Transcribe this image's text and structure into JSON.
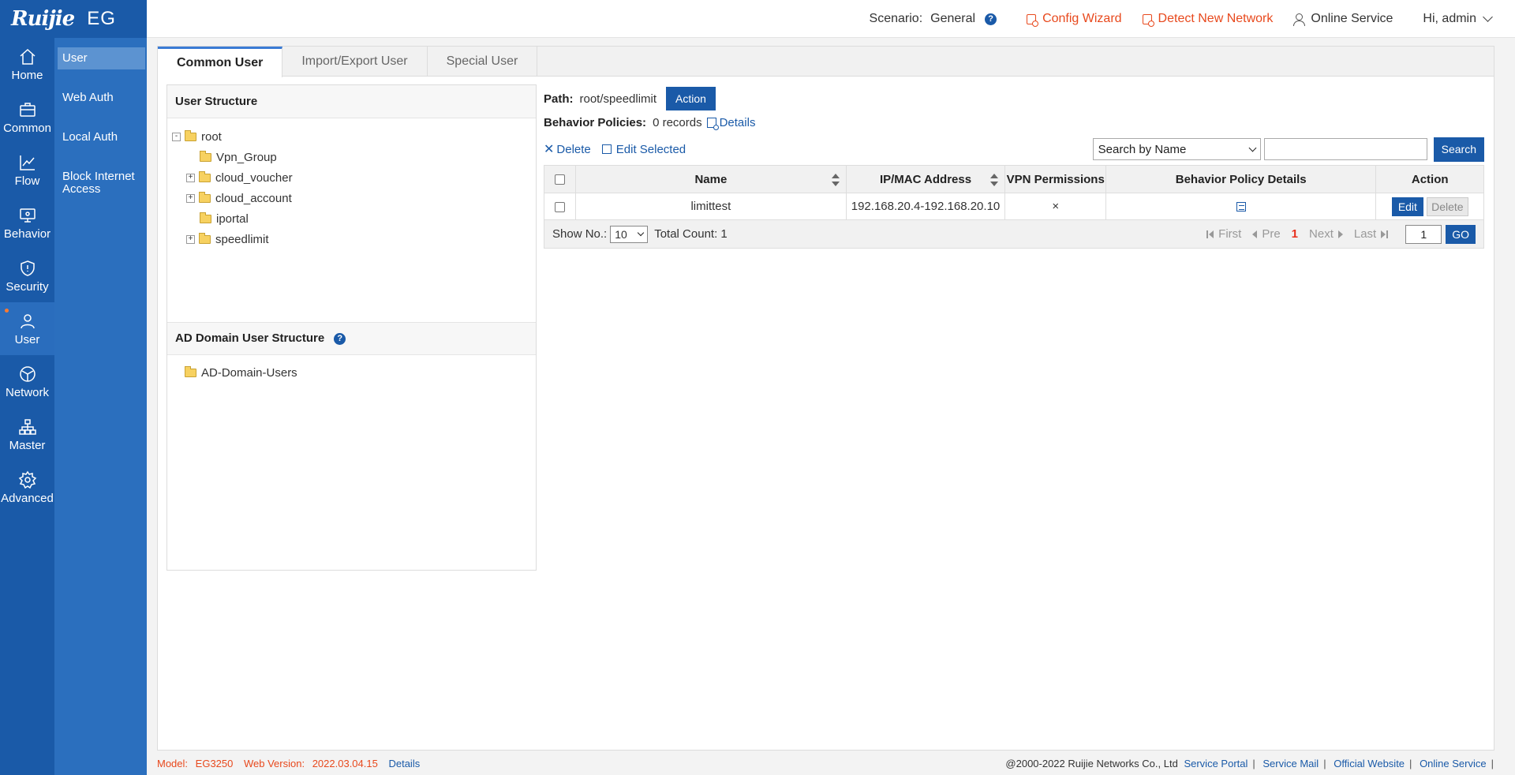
{
  "header": {
    "logo": "Ruijie",
    "product": "EG",
    "scenario_label": "Scenario:",
    "scenario_value": "General",
    "config_wizard": "Config Wizard",
    "detect_network": "Detect New Network",
    "online_service": "Online Service",
    "greeting": "Hi, admin"
  },
  "nav": [
    {
      "label": "Home",
      "icon": "home-icon"
    },
    {
      "label": "Common",
      "icon": "briefcase-icon"
    },
    {
      "label": "Flow",
      "icon": "chart-line-icon"
    },
    {
      "label": "Behavior",
      "icon": "monitor-eye-icon"
    },
    {
      "label": "Security",
      "icon": "shield-icon"
    },
    {
      "label": "User",
      "icon": "user-icon"
    },
    {
      "label": "Network",
      "icon": "globe-icon"
    },
    {
      "label": "Master",
      "icon": "hierarchy-icon"
    },
    {
      "label": "Advanced",
      "icon": "gear-icon"
    }
  ],
  "subnav": [
    "User",
    "Web Auth",
    "Local Auth",
    "Block Internet Access"
  ],
  "tabs": [
    "Common User",
    "Import/Export User",
    "Special User"
  ],
  "user_structure": {
    "title": "User Structure",
    "root": "root",
    "children": [
      "Vpn_Group",
      "cloud_voucher",
      "cloud_account",
      "iportal",
      "speedlimit"
    ]
  },
  "ad_structure": {
    "title": "AD Domain User Structure",
    "node": "AD-Domain-Users"
  },
  "path": {
    "label": "Path:",
    "value": "root/speedlimit",
    "action_button": "Action"
  },
  "behavior": {
    "label": "Behavior Policies:",
    "records": "0 records",
    "details_link": "Details"
  },
  "toolbar": {
    "delete": "Delete",
    "edit_selected": "Edit Selected",
    "search_by": "Search by Name",
    "search_value": "",
    "search_button": "Search"
  },
  "table": {
    "columns": [
      "Name",
      "IP/MAC Address",
      "VPN Permissions",
      "Behavior Policy Details",
      "Action"
    ],
    "rows": [
      {
        "name": "limittest",
        "ip": "192.168.20.4-192.168.20.10",
        "vpn": "×",
        "edit": "Edit",
        "delete": "Delete"
      }
    ]
  },
  "pager": {
    "show_label": "Show No.:",
    "page_size": "10",
    "total": "Total Count: 1",
    "first": "First",
    "pre": "Pre",
    "current": "1",
    "next": "Next",
    "last": "Last",
    "page_input": "1",
    "go": "GO"
  },
  "footer": {
    "model_label": "Model:",
    "model": "EG3250",
    "web_version_label": "Web Version:",
    "web_version": "2022.03.04.15",
    "details": "Details",
    "copyright": "@2000-2022 Ruijie Networks Co., Ltd",
    "links": [
      "Service Portal",
      "Service Mail",
      "Official Website",
      "Online Service"
    ]
  },
  "colors": {
    "brand_blue": "#1a5aa8",
    "subnav_blue": "#2b6fbe",
    "accent_orange": "#e8491d"
  }
}
